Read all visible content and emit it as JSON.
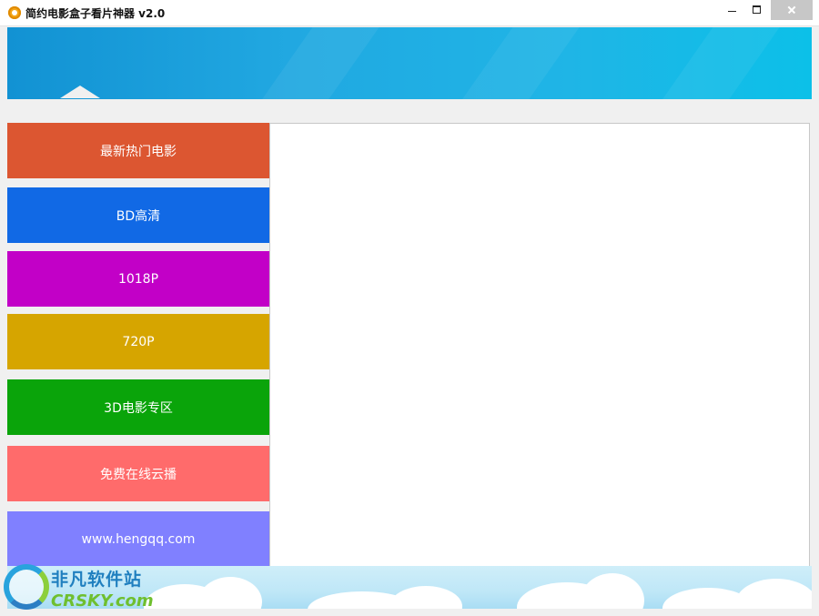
{
  "window": {
    "title": "简约电影盒子看片神器 v2.0"
  },
  "colors": {
    "banner": "#21a8e1",
    "menu_hot": "#dc5631",
    "menu_bd": "#1169e5",
    "menu_1018p": "#c200c7",
    "menu_720p": "#d6a500",
    "menu_3d": "#0aa40a",
    "menu_free": "#ff6b6b",
    "menu_site": "#8080ff"
  },
  "menu": [
    {
      "label": "最新热门电影"
    },
    {
      "label": "BD高清"
    },
    {
      "label": "1018P"
    },
    {
      "label": "720P"
    },
    {
      "label": "3D电影专区"
    },
    {
      "label": "免费在线云播"
    },
    {
      "label": "www.hengqq.com"
    }
  ],
  "watermark": {
    "cn": "非凡软件站",
    "en": "CRSKY.com"
  }
}
